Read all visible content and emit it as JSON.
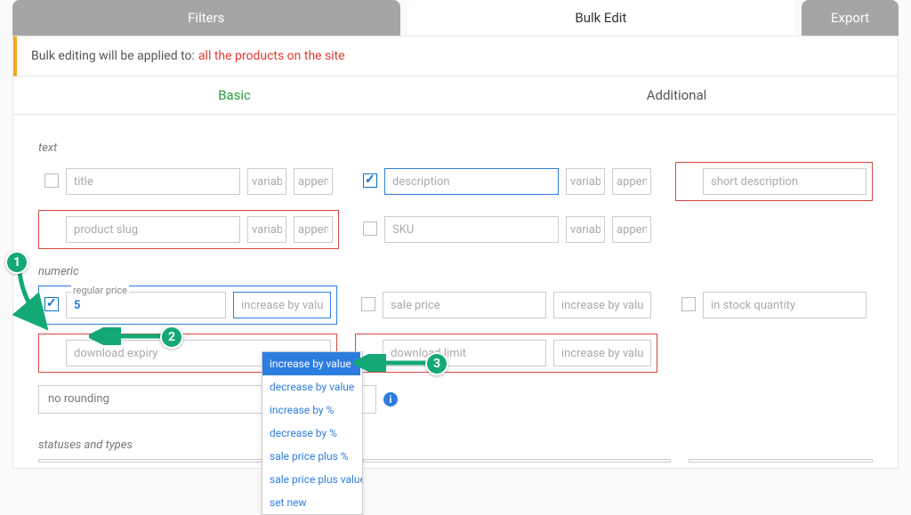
{
  "tabs": {
    "filters": "Filters",
    "bulk_edit": "Bulk Edit",
    "export": "Export"
  },
  "notice": {
    "prefix": "Bulk editing will be applied to:",
    "target": "all the products on the site"
  },
  "subtabs": {
    "basic": "Basic",
    "additional": "Additional"
  },
  "sections": {
    "text": "text",
    "numeric": "numeric",
    "statuses": "statuses and types"
  },
  "placeholders": {
    "title": "title",
    "variable": "variable",
    "append": "append",
    "description": "description",
    "short_description": "short description",
    "product_slug": "product slug",
    "sku": "SKU",
    "regular_price": "regular price",
    "sale_price": "sale price",
    "in_stock_quantity": "in stock quantity",
    "download_expiry": "download expiry",
    "download_limit": "download limit",
    "increase_by_value": "increase by value",
    "increase_by_valu": "increase by valu",
    "no_rounding": "no rounding"
  },
  "values": {
    "regular_price": "5"
  },
  "dropdown": [
    "increase by value",
    "decrease by value",
    "increase by %",
    "decrease by %",
    "sale price plus %",
    "sale price plus value",
    "set new"
  ],
  "annotations": {
    "one": "1",
    "two": "2",
    "three": "3"
  }
}
